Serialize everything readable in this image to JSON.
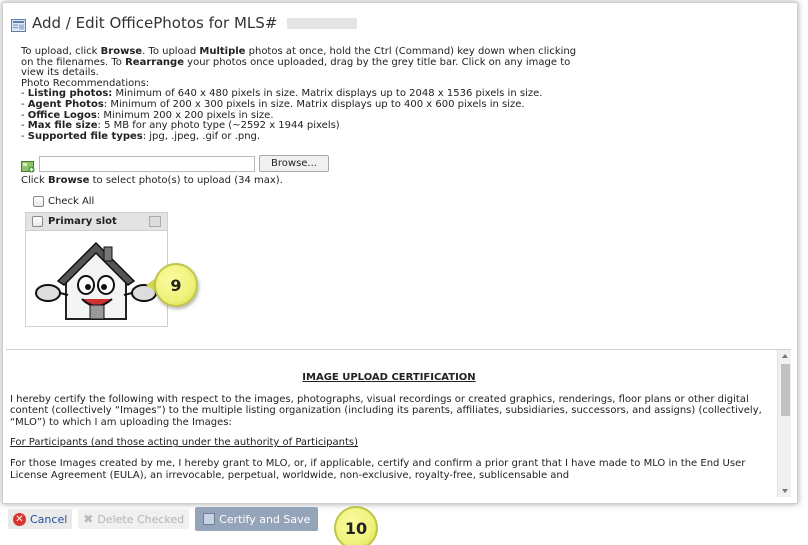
{
  "dialog": {
    "title": "Add / Edit OfficePhotos for MLS#"
  },
  "instructions": {
    "line1_a": "To upload, click ",
    "browse_word": "Browse",
    "line1_b": ". To upload ",
    "multiple_word": "Multiple",
    "line1_c": " photos at once, hold the Ctrl (Command) key down when clicking on the filenames. To ",
    "rearrange_word": "Rearrange",
    "line1_d": " your photos once uploaded, drag by the grey title bar. Click on any image to view its details.",
    "recs_header": "Photo Recommendations:",
    "rec1_label": "Listing photos:",
    "rec1_text": " Minimum of 640 x 480 pixels in size. Matrix displays up to 2048 x 1536 pixels in size.",
    "rec2_label": "Agent Photos",
    "rec2_text": ": Minimum of 200 x 300 pixels in size. Matrix displays up to 400 x 600 pixels in size.",
    "rec3_label": "Office Logos",
    "rec3_text": ": Minimum 200 x 200 pixels in size.",
    "rec4_label": "Max file size",
    "rec4_text": ": 5 MB for any photo type (~2592 x 1944 pixels)",
    "rec5_label": "Supported file types",
    "rec5_text": ": jpg, .jpeg, .gif or .png.",
    "dash": "- "
  },
  "upload": {
    "browse_label": "Browse...",
    "note_a": "Click ",
    "note_browse": "Browse",
    "note_b": " to select photo(s) to upload (34 max)."
  },
  "photos": {
    "check_all_label": "Check All",
    "slot_title": "Primary slot"
  },
  "callouts": {
    "badge_9": "9",
    "badge_10": "10"
  },
  "certification": {
    "heading": "IMAGE UPLOAD CERTIFICATION",
    "para1": "I hereby certify the following with respect to the images, photographs, visual recordings or created graphics, renderings, floor plans or other digital content (collectively “Images”) to the multiple listing organization (including its parents, affiliates, subsidiaries, successors, and assigns) (collectively, “MLO”) to which I am uploading the Images:",
    "para2": "For Participants (and those acting under the authority of Participants)",
    "para3": "For those Images created by me, I hereby grant to MLO, or, if applicable, certify and confirm a prior grant that I have made to MLO in the End User License Agreement (EULA), an irrevocable, perpetual, worldwide, non-exclusive, royalty-free, sublicensable and"
  },
  "footer": {
    "cancel_label": "Cancel",
    "delete_label": "Delete Checked",
    "certify_label": "Certify and Save"
  },
  "icons": {
    "title": "photo-gallery-icon",
    "add": "add-photo-icon",
    "cancel": "cancel-icon",
    "delete": "delete-icon",
    "save": "save-icon",
    "slot_menu": "slot-menu-icon"
  },
  "colors": {
    "certify_button": "#94a5ba",
    "cancel_icon": "#d9352c",
    "callout": "#eef27a"
  }
}
